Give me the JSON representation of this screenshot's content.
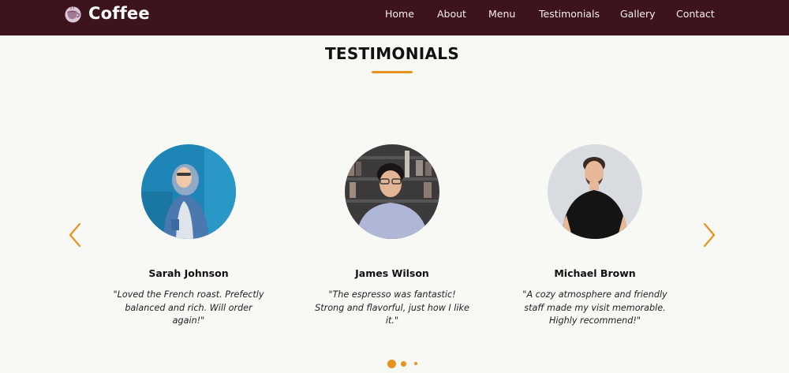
{
  "brand": {
    "name": "Coffee",
    "icon": "coffee-cup-icon"
  },
  "nav": {
    "items": [
      {
        "label": "Home"
      },
      {
        "label": "About"
      },
      {
        "label": "Menu"
      },
      {
        "label": "Testimonials"
      },
      {
        "label": "Gallery"
      },
      {
        "label": "Contact"
      }
    ]
  },
  "section": {
    "title": "TESTIMONIALS"
  },
  "testimonials": [
    {
      "name": "Sarah Johnson",
      "quote": "\"Loved the French roast. Prefectly balanced and rich. Will order again!\""
    },
    {
      "name": "James Wilson",
      "quote": "\"The espresso was fantastic! Strong and flavorful, just how I like it.\""
    },
    {
      "name": "Michael Brown",
      "quote": "\"A cozy atmosphere and friendly staff made my visit memorable. Highly recommend!\""
    }
  ],
  "carousel": {
    "active_dot": 1,
    "dot_count": 3,
    "prev_icon": "chevron-left-icon",
    "next_icon": "chevron-right-icon"
  },
  "colors": {
    "nav_bg": "#3e141c",
    "page_bg": "#f8f9f4",
    "accent": "#e8931e",
    "text": "#111111"
  }
}
